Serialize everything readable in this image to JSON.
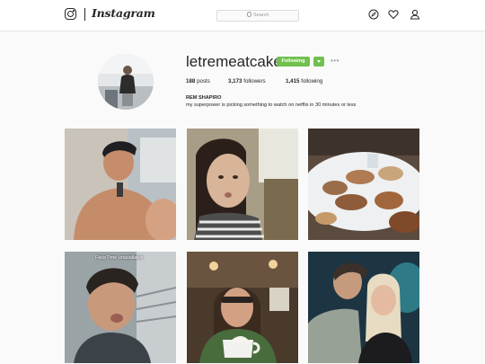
{
  "app": {
    "brand": "Instagram"
  },
  "search": {
    "placeholder": "Search"
  },
  "nav": {
    "icons": [
      "compass-icon",
      "heart-icon",
      "person-icon"
    ]
  },
  "profile": {
    "username": "letremeatcake",
    "follow_label": "Following",
    "more_label": "•••",
    "posts_count": "188",
    "posts_label": "posts",
    "followers_count": "3,173",
    "followers_label": "followers",
    "following_count": "1,415",
    "following_label": "following",
    "full_name": "REM SHAPIRO",
    "bio": "my superpower is picking something to watch on netflix in 30 minutes or less"
  },
  "posts": [
    {
      "overlay": ""
    },
    {
      "overlay": ""
    },
    {
      "overlay": ""
    },
    {
      "overlay": "FaceTime unavailable"
    },
    {
      "overlay": ""
    },
    {
      "overlay": ""
    }
  ],
  "colors": {
    "accent_green": "#70c050",
    "background": "#fafafa",
    "border": "#dbdbdb"
  }
}
